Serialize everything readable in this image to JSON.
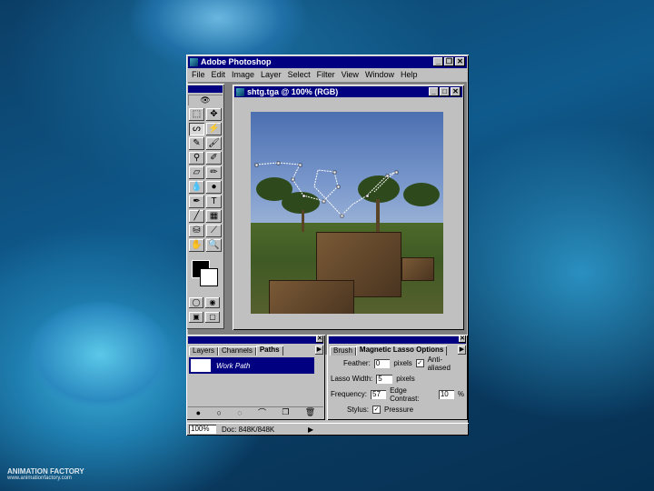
{
  "app": {
    "title": "Adobe Photoshop"
  },
  "menu": [
    "File",
    "Edit",
    "Image",
    "Layer",
    "Select",
    "Filter",
    "View",
    "Window",
    "Help"
  ],
  "document": {
    "title": "shtg.tga @ 100% (RGB)"
  },
  "paths_palette": {
    "tabs": [
      "Layers",
      "Channels",
      "Paths"
    ],
    "active_tab": "Paths",
    "path_name": "Work Path"
  },
  "options_palette": {
    "tabs": [
      "Brush",
      "Magnetic Lasso Options"
    ],
    "active_tab": "Magnetic Lasso Options",
    "feather_label": "Feather:",
    "feather_value": "0",
    "feather_unit": "pixels",
    "antialias_label": "Anti-aliased",
    "lasso_width_label": "Lasso Width:",
    "lasso_width_value": "5",
    "lasso_width_unit": "pixels",
    "frequency_label": "Frequency:",
    "frequency_value": "57",
    "edge_contrast_label": "Edge Contrast:",
    "edge_contrast_value": "10",
    "edge_contrast_unit": "%",
    "stylus_label": "Stylus:",
    "pressure_label": "Pressure"
  },
  "status": {
    "zoom": "100%",
    "doc": "Doc: 848K/848K"
  },
  "branding": {
    "name": "ANIMATION FACTORY",
    "url": "www.animationfactory.com"
  },
  "colors": {
    "titlebar": "#000080",
    "chrome": "#c0c0c0"
  }
}
